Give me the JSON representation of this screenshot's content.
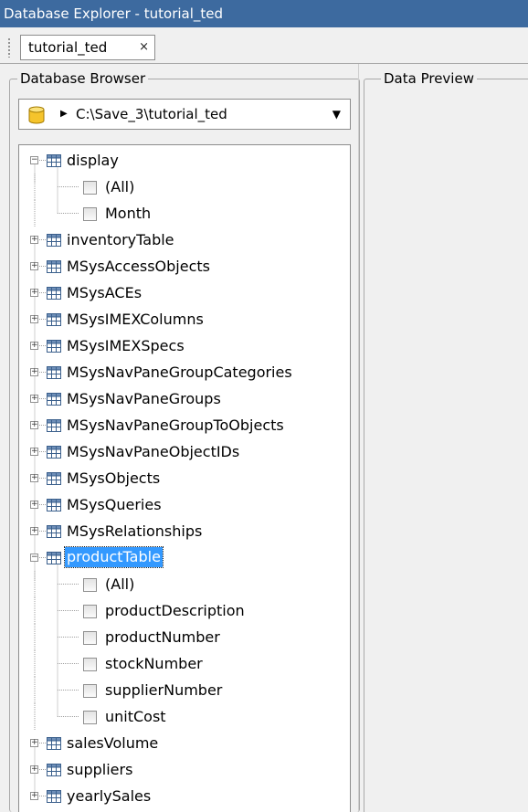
{
  "window": {
    "title": "Database Explorer - tutorial_ted"
  },
  "tabs": [
    {
      "label": "tutorial_ted",
      "close_glyph": "×"
    }
  ],
  "database_browser": {
    "legend": "Database Browser",
    "source": {
      "icon": "database-icon",
      "path": "C:\\Save_3\\tutorial_ted"
    },
    "tree": [
      {
        "label": "display",
        "type": "table",
        "expanded": true,
        "children": [
          {
            "label": "(All)"
          },
          {
            "label": "Month"
          }
        ]
      },
      {
        "label": "inventoryTable",
        "type": "table",
        "expanded": false
      },
      {
        "label": "MSysAccessObjects",
        "type": "table",
        "expanded": false
      },
      {
        "label": "MSysACEs",
        "type": "table",
        "expanded": false
      },
      {
        "label": "MSysIMEXColumns",
        "type": "table",
        "expanded": false
      },
      {
        "label": "MSysIMEXSpecs",
        "type": "table",
        "expanded": false
      },
      {
        "label": "MSysNavPaneGroupCategories",
        "type": "table",
        "expanded": false
      },
      {
        "label": "MSysNavPaneGroups",
        "type": "table",
        "expanded": false
      },
      {
        "label": "MSysNavPaneGroupToObjects",
        "type": "table",
        "expanded": false
      },
      {
        "label": "MSysNavPaneObjectIDs",
        "type": "table",
        "expanded": false
      },
      {
        "label": "MSysObjects",
        "type": "table",
        "expanded": false
      },
      {
        "label": "MSysQueries",
        "type": "table",
        "expanded": false
      },
      {
        "label": "MSysRelationships",
        "type": "table",
        "expanded": false
      },
      {
        "label": "productTable",
        "type": "table",
        "expanded": true,
        "selected": true,
        "children": [
          {
            "label": "(All)"
          },
          {
            "label": "productDescription"
          },
          {
            "label": "productNumber"
          },
          {
            "label": "stockNumber"
          },
          {
            "label": "supplierNumber"
          },
          {
            "label": "unitCost"
          }
        ]
      },
      {
        "label": "salesVolume",
        "type": "table",
        "expanded": false
      },
      {
        "label": "suppliers",
        "type": "table",
        "expanded": false
      },
      {
        "label": "yearlySales",
        "type": "table",
        "expanded": false
      }
    ]
  },
  "data_preview": {
    "legend": "Data Preview"
  },
  "colors": {
    "title_bar": "#3d6a9f",
    "selection": "#3399ff"
  }
}
